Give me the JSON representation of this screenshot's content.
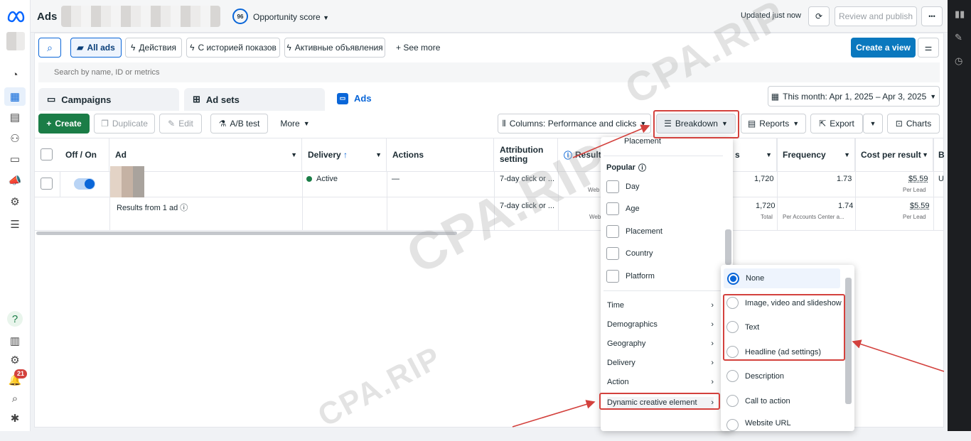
{
  "header": {
    "title": "Ads",
    "opportunity_score": "96",
    "opportunity_label": "Opportunity score",
    "updated": "Updated just now",
    "review_publish": "Review and publish",
    "more": "•••"
  },
  "filters": {
    "all_ads": "All ads",
    "f1": "Действия",
    "f2": "С историей показов",
    "f3": "Активные объявления",
    "see_more": "See more",
    "create_view": "Create a view",
    "search_placeholder": "Search by name, ID or metrics"
  },
  "tabs": {
    "campaigns": "Campaigns",
    "adsets": "Ad sets",
    "ads": "Ads"
  },
  "date_range": "This month: Apr 1, 2025 – Apr 3, 2025",
  "toolbar": {
    "create": "Create",
    "duplicate": "Duplicate",
    "edit": "Edit",
    "ab_test": "A/B test",
    "more": "More",
    "columns": "Columns: Performance and clicks",
    "breakdown": "Breakdown",
    "reports": "Reports",
    "export": "Export",
    "charts": "Charts"
  },
  "table": {
    "headers": {
      "offon": "Off / On",
      "ad": "Ad",
      "delivery": "Delivery",
      "delivery_sort": "↑",
      "actions": "Actions",
      "attribution": "Attribution setting",
      "results": "Results",
      "reach_suffix": "s",
      "frequency": "Frequency",
      "cpr": "Cost per result",
      "b": "B"
    },
    "row1": {
      "delivery": "Active",
      "actions": "—",
      "attribution": "7-day click or ...",
      "results_sub": "Web",
      "reach": "1,720",
      "frequency": "1.73",
      "cpr": "$5.59",
      "cpr_sub": "Per Lead",
      "b": "U"
    },
    "summary": {
      "label": "Results from 1 ad",
      "attribution": "7-day click or ...",
      "results_sub": "Web",
      "reach": "1,720",
      "reach_sub": "Total",
      "frequency": "1.74",
      "frequency_sub": "Per Accounts Center a...",
      "cpr": "$5.59",
      "cpr_sub": "Per Lead"
    }
  },
  "breakdown_menu": {
    "top_item": "Placement",
    "popular": "Popular",
    "items": [
      "Day",
      "Age",
      "Placement",
      "Country",
      "Platform"
    ],
    "submenus": [
      "Time",
      "Demographics",
      "Geography",
      "Delivery",
      "Action",
      "Dynamic creative element"
    ]
  },
  "dce_menu": {
    "items": [
      "None",
      "Image, video and slideshow",
      "Text",
      "Headline (ad settings)",
      "Description",
      "Call to action",
      "Website URL"
    ]
  },
  "watermark": "CPA.RIP",
  "notifications": "21",
  "colors": {
    "accent": "#0a66d8",
    "green": "#1b7d47",
    "red_annotation": "#d3413d"
  }
}
